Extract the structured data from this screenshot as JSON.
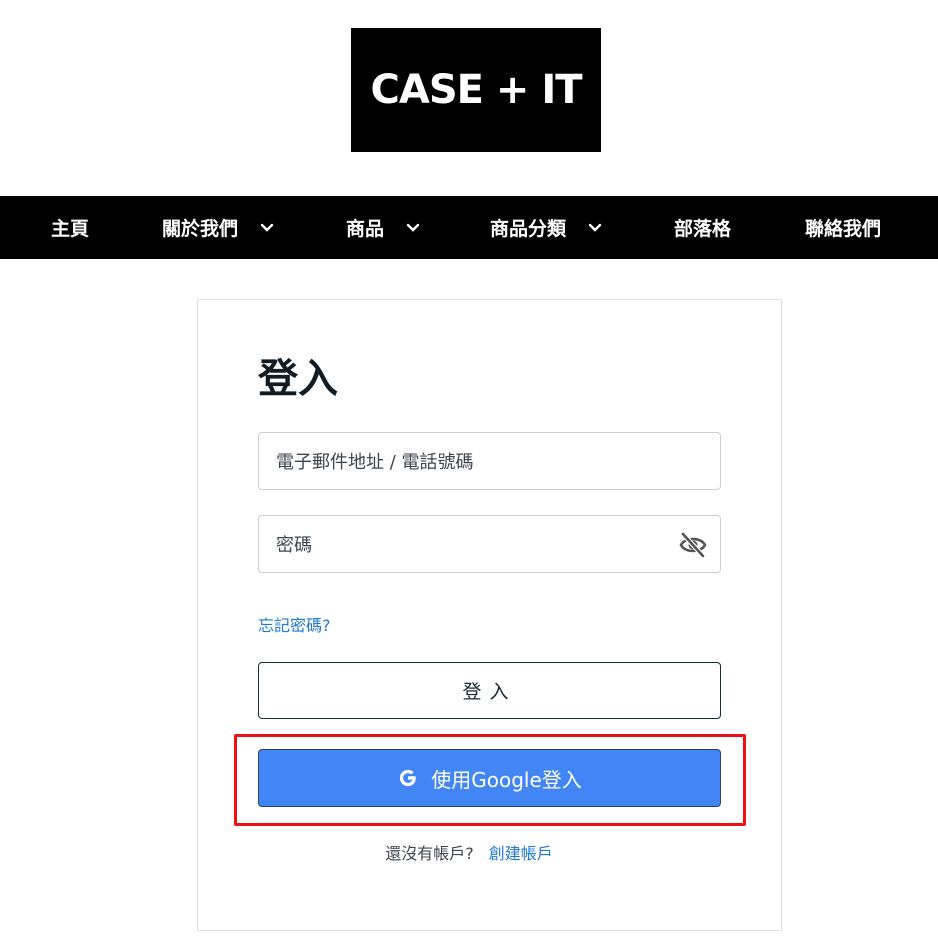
{
  "logo": {
    "text": "CASE + IT"
  },
  "nav": {
    "items": [
      {
        "label": "主頁",
        "dropdown": false
      },
      {
        "label": "關於我們",
        "dropdown": true
      },
      {
        "label": "商品",
        "dropdown": true
      },
      {
        "label": "商品分類",
        "dropdown": true
      },
      {
        "label": "部落格",
        "dropdown": false
      },
      {
        "label": "聯絡我們",
        "dropdown": false
      }
    ]
  },
  "login": {
    "title": "登入",
    "email_placeholder": "電子郵件地址 / 電話號碼",
    "password_placeholder": "密碼",
    "forgot_label": "忘記密碼?",
    "submit_label": "登入",
    "google_label": "使用Google登入",
    "signup_prompt": "還沒有帳戶?",
    "signup_link": "創建帳戶"
  },
  "colors": {
    "nav_bg": "#000000",
    "link": "#1f7ad1",
    "google_button": "#4285f4",
    "highlight": "#ee1111"
  },
  "icons": {
    "password_toggle": "eye-slash-icon",
    "google": "google-g-icon",
    "dropdown": "chevron-down-icon"
  }
}
